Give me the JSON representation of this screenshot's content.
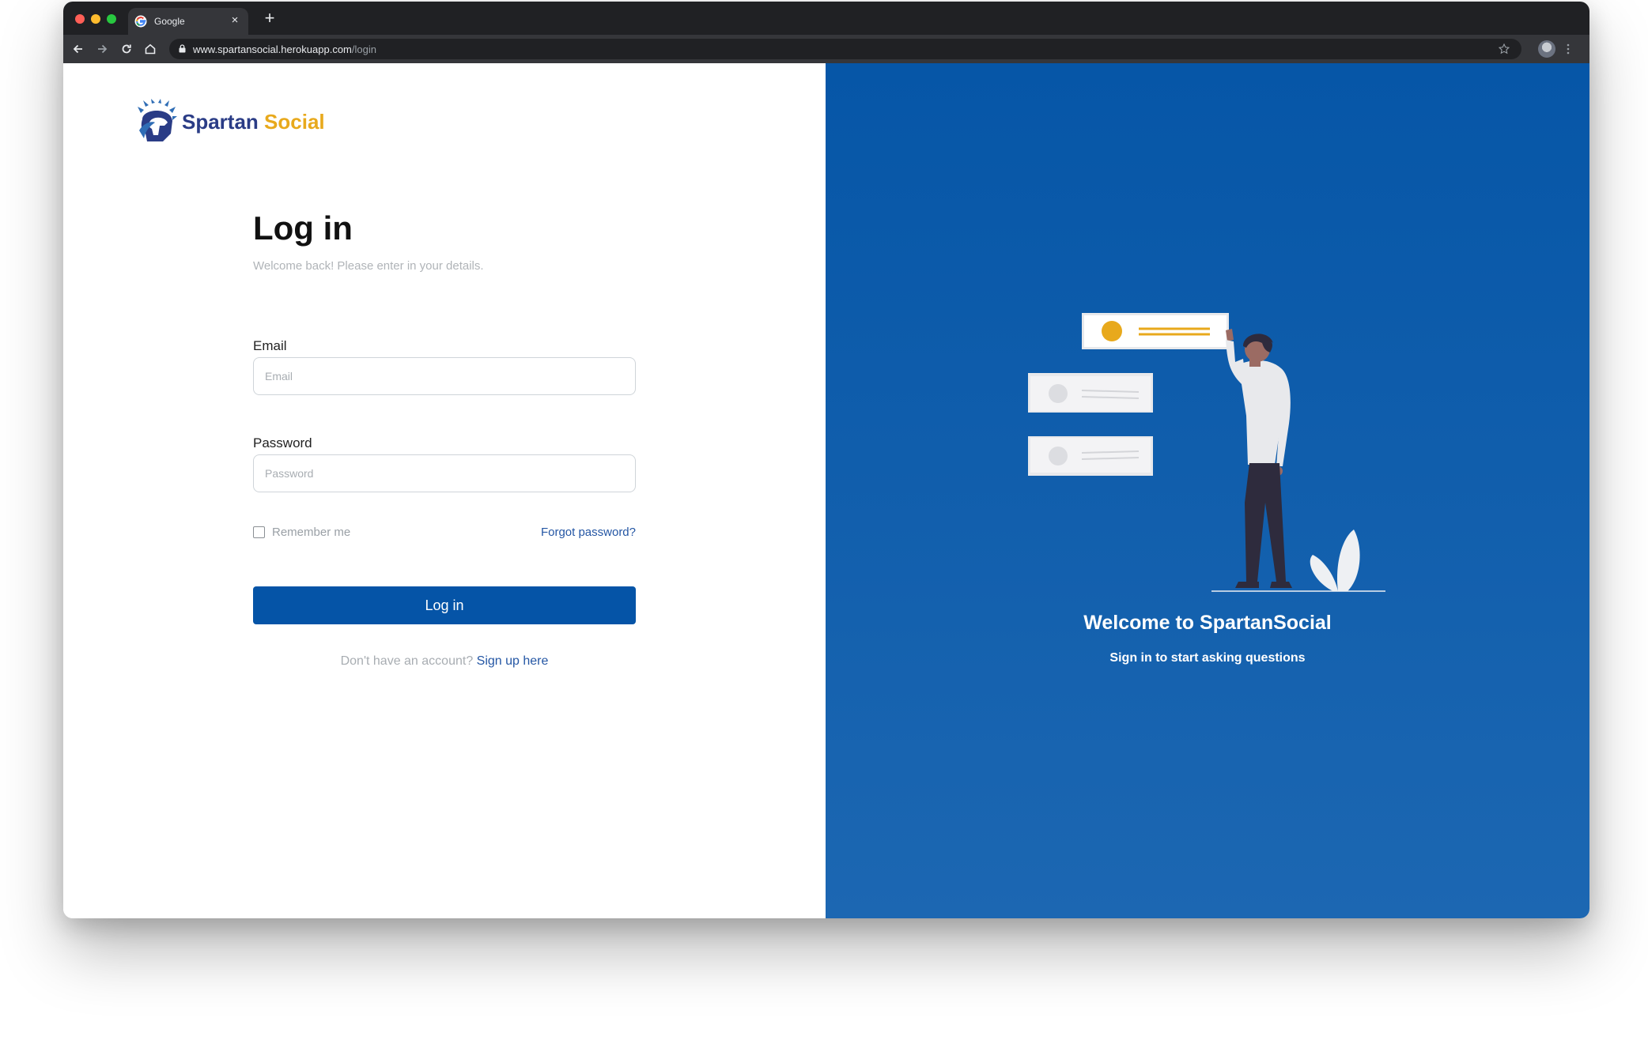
{
  "browser": {
    "tab_title": "Google",
    "tab_close": "×",
    "new_tab": "+",
    "url_host": "www.spartansocial.herokuapp.com",
    "url_path": "/login"
  },
  "brand": {
    "word1": "Spartan",
    "word2": "Social",
    "color_primary": "#2a3c86",
    "color_accent": "#e8a91c"
  },
  "login": {
    "title": "Log in",
    "subtitle": "Welcome back! Please enter in your details.",
    "email_label": "Email",
    "email_placeholder": "Email",
    "password_label": "Password",
    "password_placeholder": "Password",
    "remember_label": "Remember me",
    "forgot_link": "Forgot password?",
    "submit_label": "Log in",
    "signup_prompt": "Don't have an account?",
    "signup_link": "Sign up here",
    "button_color": "#0554a7"
  },
  "hero": {
    "title": "Welcome to SpartanSocial",
    "subtitle": "Sign in to start asking questions",
    "background_color": "#0656a7"
  }
}
